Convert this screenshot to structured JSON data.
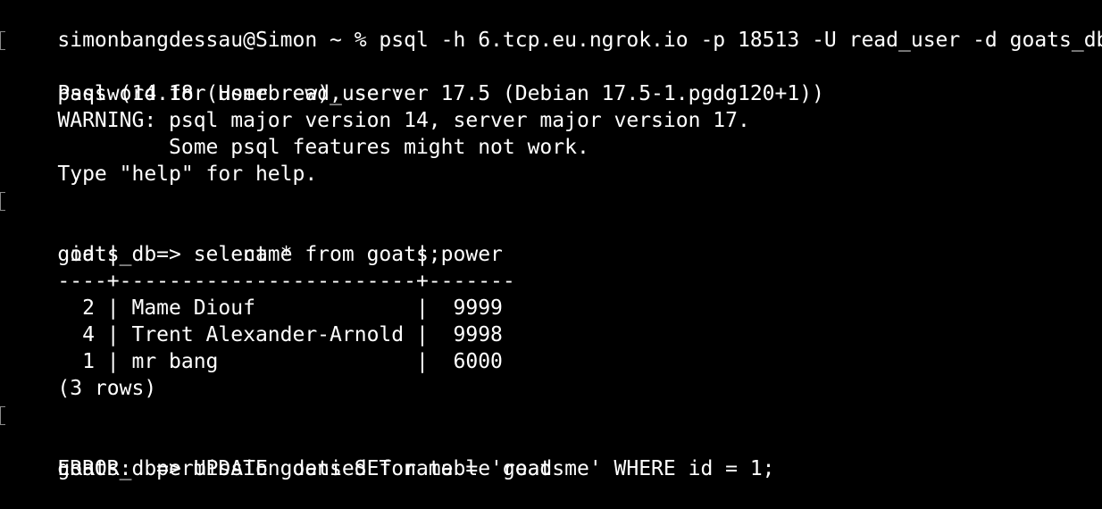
{
  "terminal": {
    "lines": [
      "simonbangdessau@Simon ~ % psql -h 6.tcp.eu.ngrok.io -p 18513 -U read_user -d goats_db",
      "Password for user read_user:",
      "psql (14.18 (Homebrew), server 17.5 (Debian 17.5-1.pgdg120+1))",
      "WARNING: psql major version 14, server major version 17.",
      "         Some psql features might not work.",
      "Type \"help\" for help.",
      "",
      "goats_db=> select * from goats;",
      " id |          name          | power",
      "----+------------------------+-------",
      "  2 | Mame Diouf             |  9999",
      "  4 | Trent Alexander-Arnold |  9998",
      "  1 | mr bang                |  6000",
      "(3 rows)",
      "",
      "goats_db=> UPDATE goats SET name = 'read me' WHERE id = 1;",
      "ERROR:  permission denied for table goats"
    ]
  }
}
